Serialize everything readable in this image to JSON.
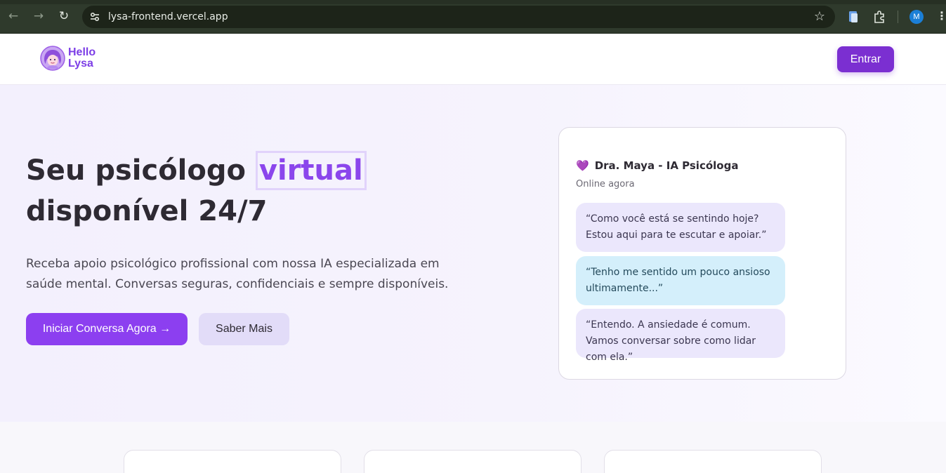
{
  "browser": {
    "url": "lysa-frontend.vercel.app",
    "profile_initial": "M",
    "icons": [
      "back-icon",
      "forward-icon",
      "reload-icon",
      "site-settings-icon",
      "bookmark-star-icon",
      "extension-document-icon",
      "extensions-puzzle-icon",
      "kebab-menu-icon"
    ]
  },
  "header": {
    "logo_line1": "Hello",
    "logo_line2": "Lysa",
    "enter_label": "Entrar"
  },
  "hero": {
    "title_before": "Seu psicólogo ",
    "title_highlight": "virtual",
    "title_after": " disponível 24/7",
    "subtitle": "Receba apoio psicológico profissional com nossa IA especializada em saúde mental. Conversas seguras, confidenciais e sempre disponíveis.",
    "primary_cta": "Iniciar Conversa Agora →",
    "secondary_cta": "Saber Mais"
  },
  "chat": {
    "heart": "💜",
    "title": "Dra. Maya - IA Psicóloga",
    "status": "Online agora",
    "messages": [
      {
        "from": "ai",
        "text": "“Como você está se sentindo hoje? Estou aqui para te escutar e apoiar.”"
      },
      {
        "from": "user",
        "text": "“Tenho me sentido um pouco ansioso ultimamente...”"
      },
      {
        "from": "ai",
        "text": "“Entendo. A ansiedade é comum. Vamos conversar sobre como lidar com ela.”"
      }
    ]
  },
  "colors": {
    "brand_purple": "#7b2fd1",
    "cta_purple": "#8c3ff0",
    "highlight_purple": "#8b46ec",
    "ai_bubble": "#ebe7fc",
    "user_bubble": "#d4effb"
  }
}
